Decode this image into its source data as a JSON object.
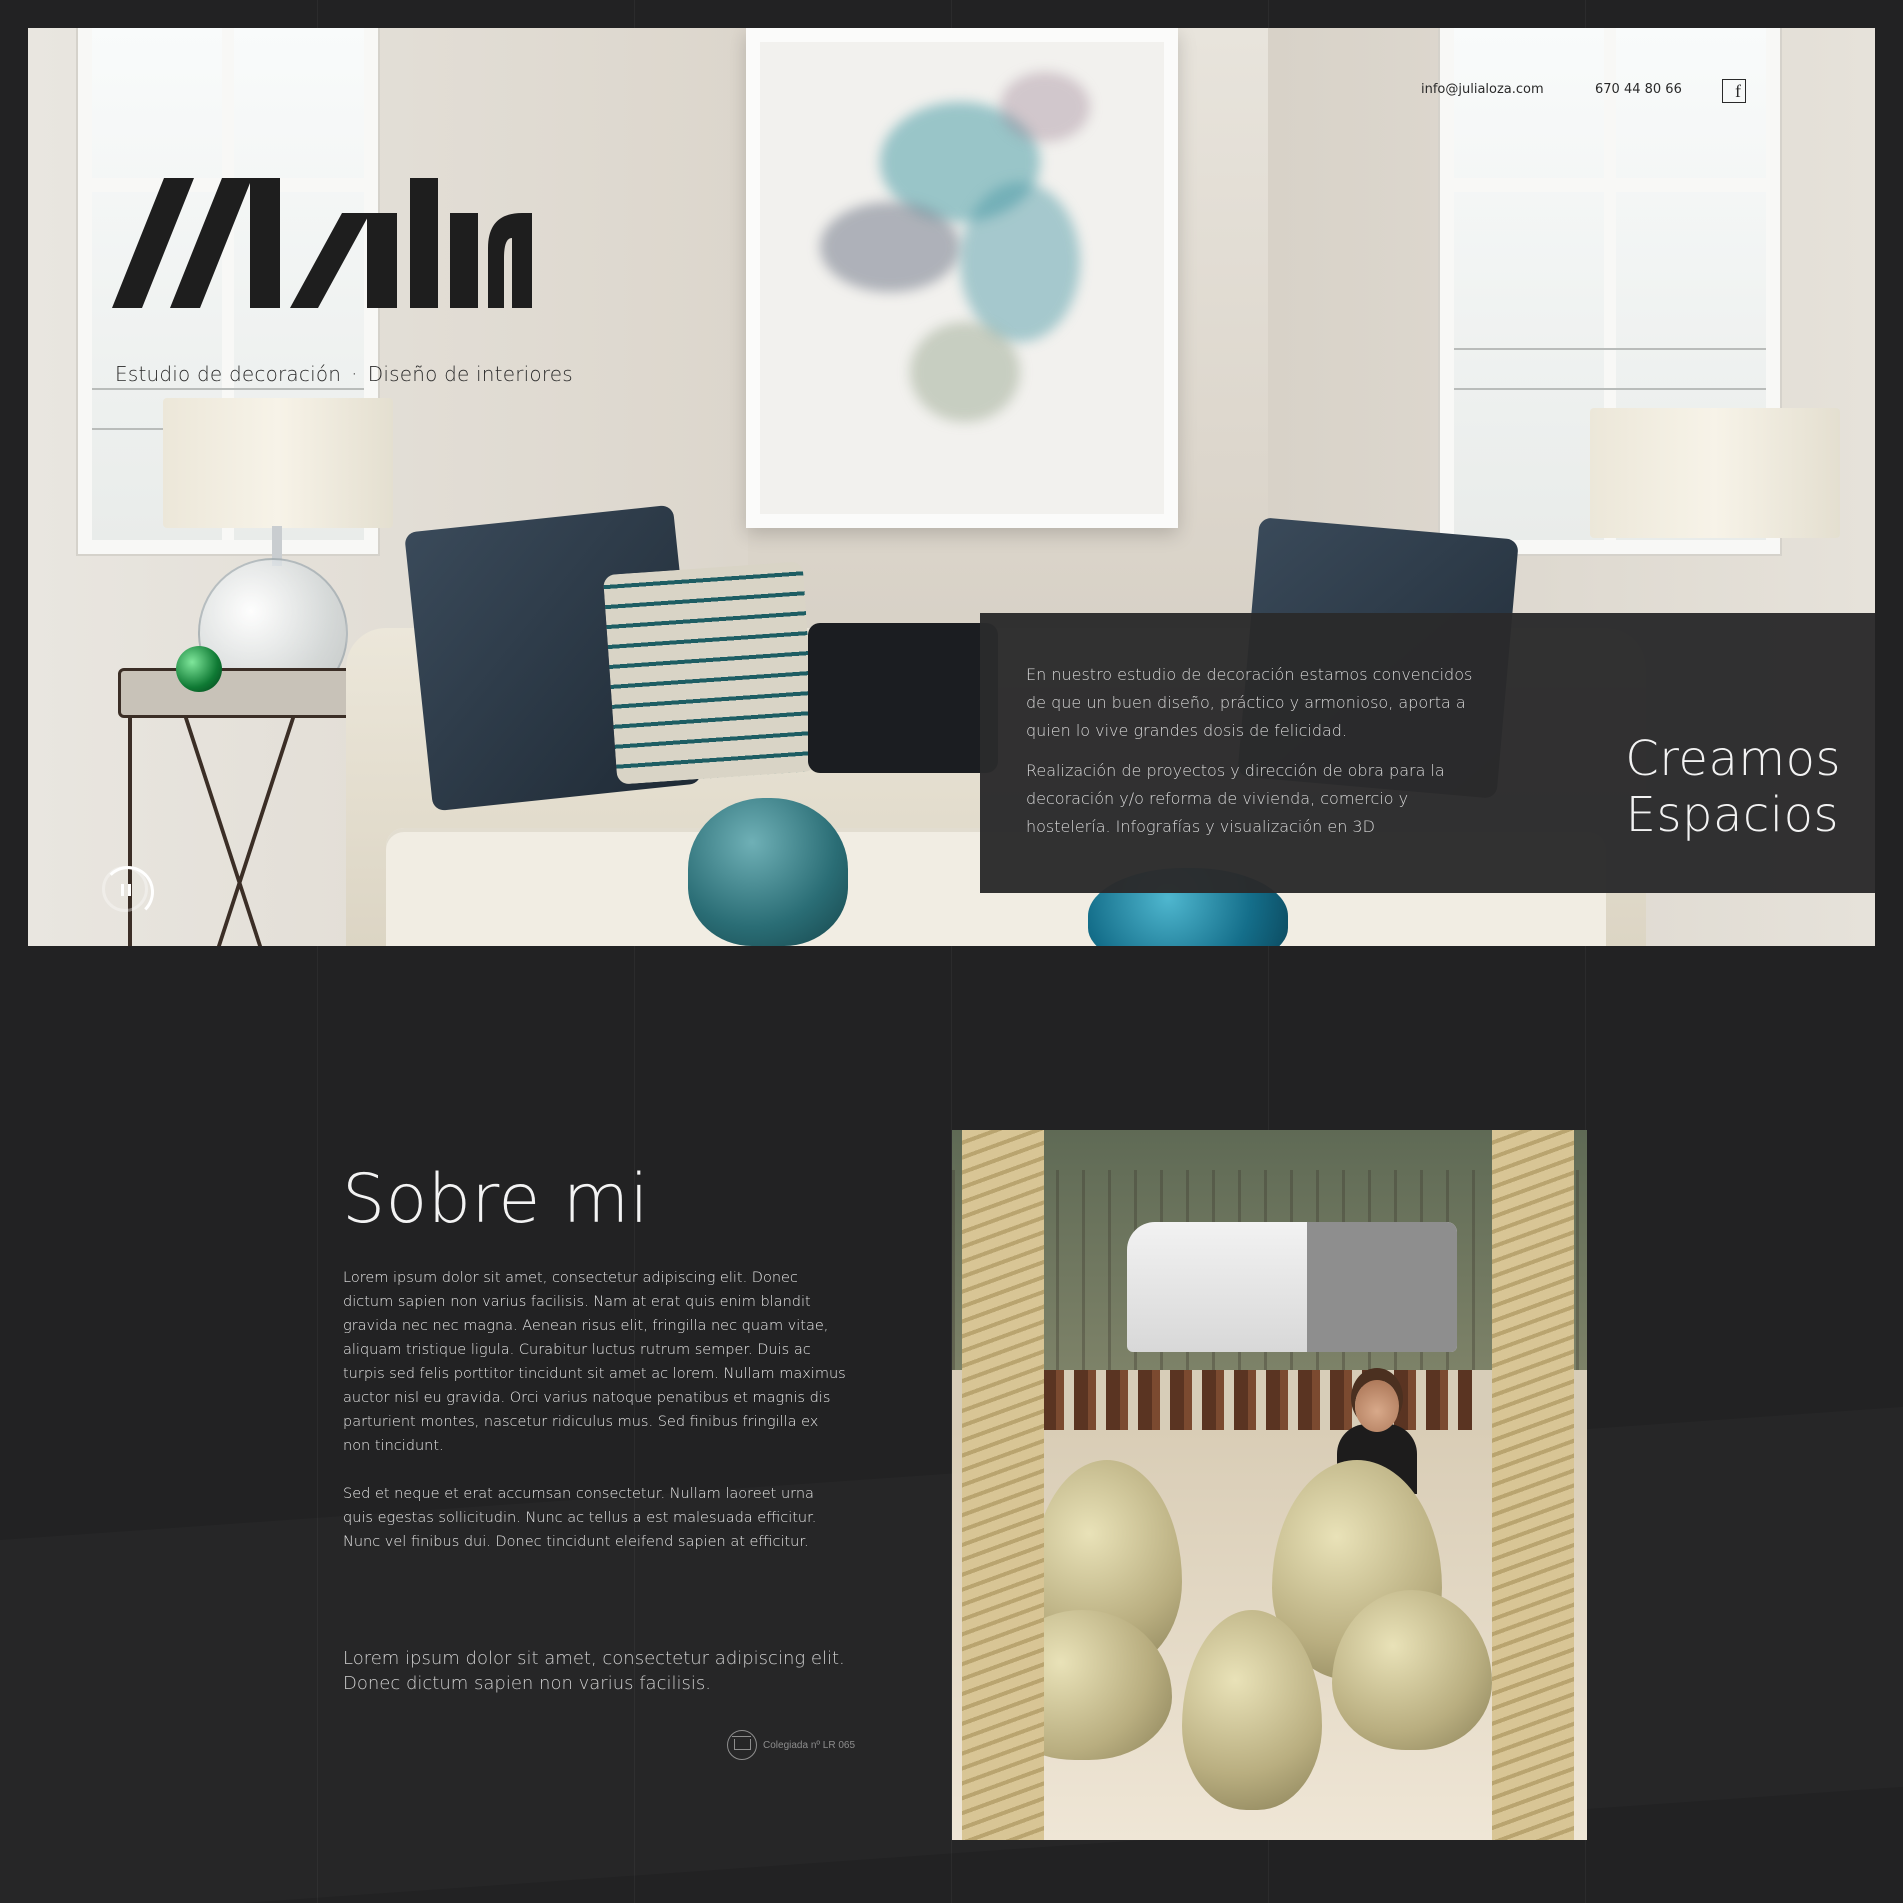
{
  "header": {
    "logo_text": "Julia",
    "subtitle_left": "Estudio de decoración",
    "subtitle_sep": "·",
    "subtitle_right": "Diseño de interiores",
    "email": "info@julialoza.com",
    "phone": "670 44 80 66",
    "facebook_label": "f"
  },
  "hero": {
    "paragraph1": "En nuestro estudio de decoración estamos convencidos de que un buen diseño, práctico y armonioso, aporta a quien lo vive grandes dosis de felicidad.",
    "paragraph2": "Realización de proyectos y dirección de obra para la decoración y/o reforma de vivienda, comercio y hostelería. Infografías y visualización en 3D",
    "tagline_line1": "Creamos",
    "tagline_line2": "Espacios",
    "slider_control": "pause"
  },
  "about": {
    "title": "Sobre mi",
    "paragraph1": "Lorem ipsum dolor sit amet, consectetur adipiscing elit. Donec dictum sapien non varius facilisis. Nam at erat quis enim blandit gravida nec nec magna. Aenean risus elit, fringilla nec quam vitae, aliquam tristique ligula. Curabitur luctus rutrum semper. Duis ac turpis sed felis porttitor tincidunt sit amet ac lorem. Nullam maximus auctor nisl eu gravida. Orci varius natoque penatibus et magnis dis parturient montes, nascetur ridiculus mus. Sed finibus fringilla ex non tincidunt.",
    "paragraph2": "Sed et neque et erat accumsan consectetur. Nullam laoreet urna quis egestas sollicitudin. Nunc ac tellus a est malesuada efficitur. Nunc vel finibus dui. Donec tincidunt eleifend sapien at efficitur.",
    "quote": "Lorem ipsum dolor sit amet, consectetur adipiscing elit. Donec dictum sapien non varius facilisis.",
    "colegiada": "Colegiada nº LR 065"
  },
  "colors": {
    "page_bg": "#222223",
    "overlay_bg": "#2a2a2b",
    "text_light": "#f2f2f2",
    "text_dark": "#2a2a2a"
  },
  "icons": {
    "facebook": "facebook-icon",
    "pause": "pause-icon",
    "seal": "colegiada-seal-icon"
  }
}
